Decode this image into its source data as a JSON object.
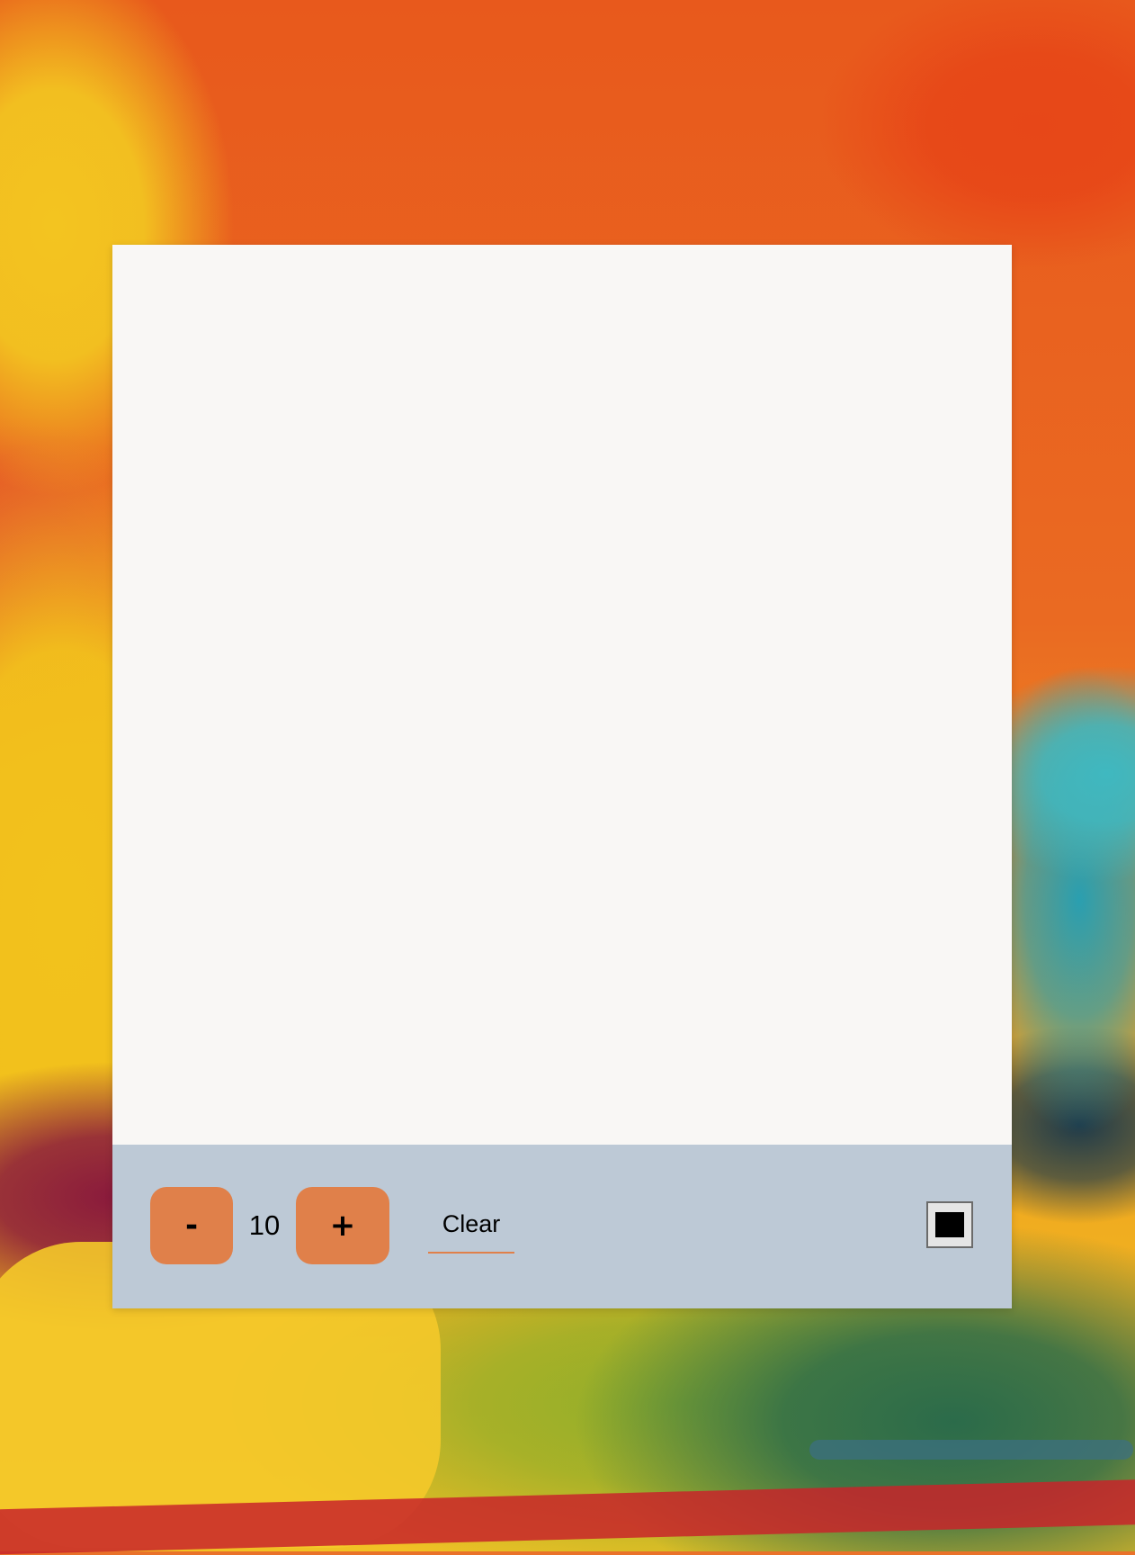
{
  "toolbar": {
    "decrease_label": "-",
    "brush_size": "10",
    "increase_label": "+",
    "clear_label": "Clear",
    "selected_color": "#000000"
  },
  "colors": {
    "canvas_background": "#f9f7f5",
    "toolbar_background": "#bdc9d6",
    "button_accent": "#e0804a"
  }
}
